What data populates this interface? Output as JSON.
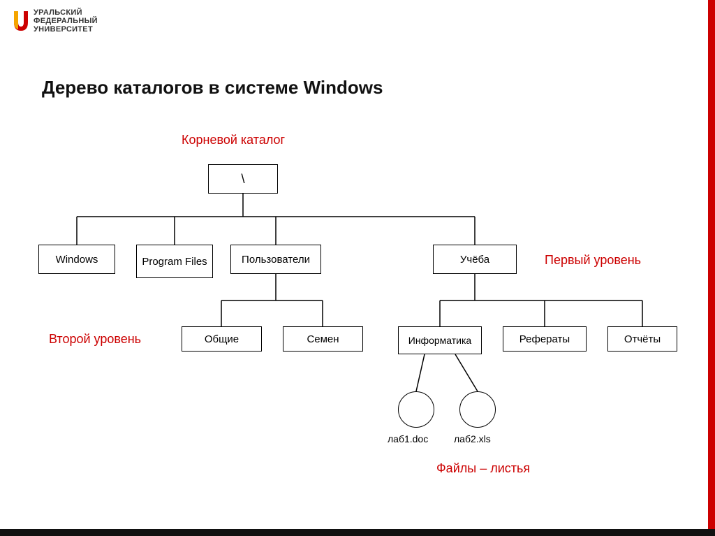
{
  "logo": {
    "line1": "Уральский",
    "line2": "федеральный",
    "line3": "университет"
  },
  "title": "Дерево каталогов в системе Windows",
  "labels": {
    "root": "Корневой каталог",
    "first": "Первый уровень",
    "second": "Второй уровень",
    "files": "Файлы – листья"
  },
  "tree": {
    "root": "\\",
    "level1": {
      "windows": "Windows",
      "program_files": "Program Files",
      "users": "Пользователи",
      "study": "Учёба"
    },
    "level2": {
      "common": "Общие",
      "semen": "Семен",
      "informatics": "Информатика",
      "referats": "Рефераты",
      "reports": "Отчёты"
    },
    "files": {
      "f1": "лаб1.doc",
      "f2": "лаб2.xls"
    }
  }
}
